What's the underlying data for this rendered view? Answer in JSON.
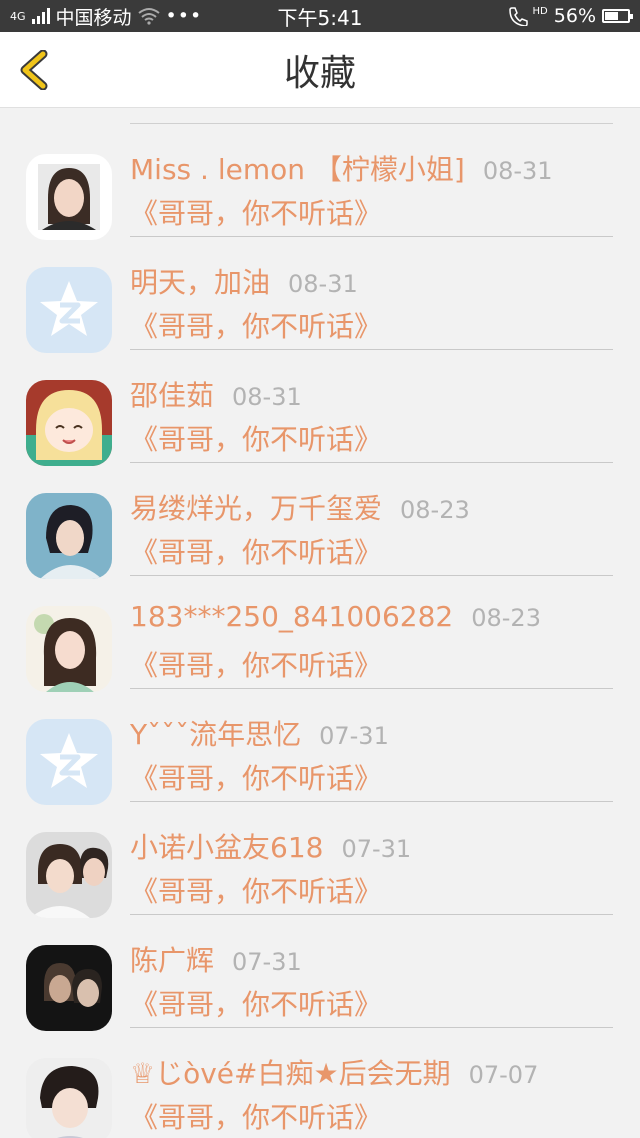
{
  "status_bar": {
    "carrier": "中国移动",
    "network": "4G",
    "time": "下午5:41",
    "hd": "HD",
    "battery": "56%"
  },
  "nav": {
    "back_icon": "chevron-left-icon",
    "title": "收藏"
  },
  "colors": {
    "accent": "#e8966a",
    "date": "#b3b3b3",
    "back_chevron": "#f0c419"
  },
  "items": [
    {
      "name": "Miss . lemon 【柠檬小姐]",
      "date": "08-31",
      "quote": "《哥哥，你不听话》",
      "avatar": "photo-girl"
    },
    {
      "name": "明天，加油",
      "date": "08-31",
      "quote": "《哥哥，你不听话》",
      "avatar": "qq-default"
    },
    {
      "name": "邵佳茹",
      "date": "08-31",
      "quote": "《哥哥，你不听话》",
      "avatar": "anime-girl"
    },
    {
      "name": "易缕烊光，万千玺爱",
      "date": "08-23",
      "quote": "《哥哥，你不听话》",
      "avatar": "photo-man"
    },
    {
      "name": "183***250_841006282",
      "date": "08-23",
      "quote": "《哥哥，你不听话》",
      "avatar": "photo-girl-2"
    },
    {
      "name": "Yˇˇˇ流年思忆",
      "date": "07-31",
      "quote": "《哥哥，你不听话》",
      "avatar": "qq-default"
    },
    {
      "name": "小诺小盆友618",
      "date": "07-31",
      "quote": "《哥哥，你不听话》",
      "avatar": "photo-boys"
    },
    {
      "name": "陈广辉",
      "date": "07-31",
      "quote": "《哥哥，你不听话》",
      "avatar": "photo-dark"
    },
    {
      "name": "♕じòvé#白痴★后会无期",
      "date": "07-07",
      "quote": "《哥哥，你不听话》",
      "avatar": "photo-boy"
    }
  ]
}
